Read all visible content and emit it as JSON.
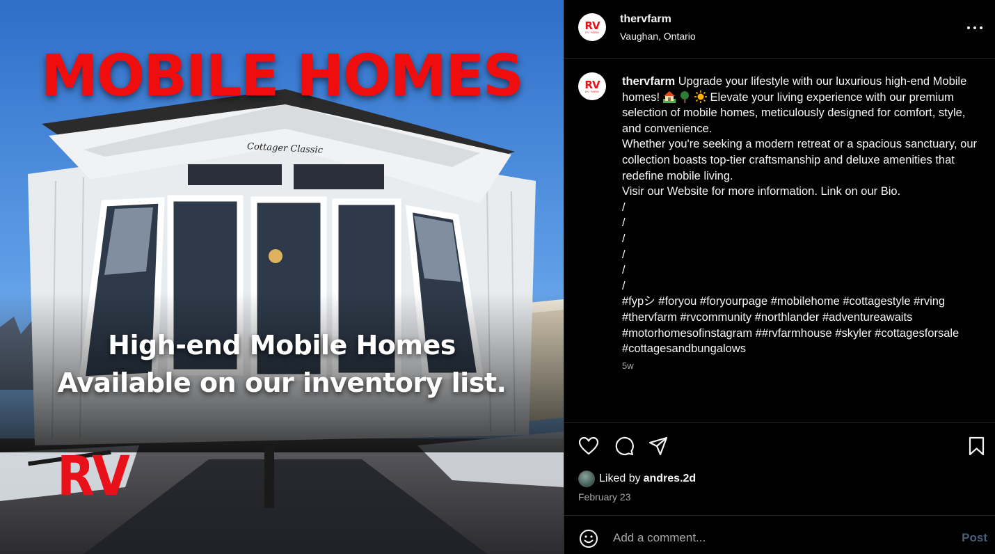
{
  "post_image": {
    "headline": "MOBILE HOMES",
    "house_sign": "Cottager Classic",
    "subtitle_line1": "High-end Mobile Homes",
    "subtitle_line2": "Available on our inventory list.",
    "logo_text": "RV"
  },
  "header": {
    "avatar_text": "RV",
    "avatar_subtext": "RV FARM",
    "username": "thervfarm",
    "location": "Vaughan, Ontario",
    "more_icon": "more-horizontal-icon"
  },
  "caption": {
    "username": "thervfarm",
    "text_part1": "Upgrade your lifestyle with our luxurious high-end Mobile homes! ",
    "emojis": [
      "house-with-garden-emoji",
      "tree-emoji",
      "sun-emoji"
    ],
    "text_part2": " Elevate your living experience with our premium selection of mobile homes, meticulously designed for comfort, style, and convenience.\nWhether you're seeking a modern retreat or a spacious sanctuary, our collection boasts top-tier craftsmanship and deluxe amenities that redefine mobile living.\nVisir our Website for more information. Link on our Bio.\n/\n/\n/\n/\n/\n/\n#fypシ #foryou #foryourpage #mobilehome #cottagestyle #rving #thervfarm #rvcommunity #northlander #adventureawaits #motorhomesofinstagram ##rvfarmhouse #skyler #cottagesforsale #cottagesandbungalows",
    "time_ago": "5w"
  },
  "actions": {
    "icons": [
      "heart-icon",
      "comment-icon",
      "share-icon",
      "bookmark-icon"
    ],
    "liked_by_prefix": "Liked by",
    "liked_by_user": "andres.2d",
    "date": "February 23"
  },
  "comment": {
    "placeholder": "Add a comment...",
    "post_label": "Post"
  },
  "colors": {
    "headline_red": "#f00d0d",
    "logo_red": "#e8111a",
    "post_button": "#4a5e7a",
    "secondary_text": "#a8a8a8"
  }
}
